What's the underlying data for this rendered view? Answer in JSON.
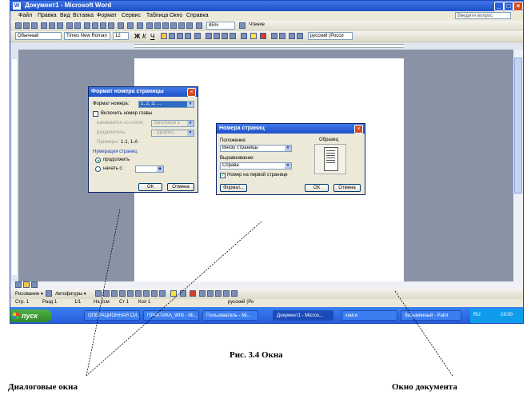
{
  "window": {
    "title": "Документ1 - Microsoft Word",
    "menu": [
      "Файл",
      "Правка",
      "Вид",
      "Вставка",
      "Формат",
      "Сервис",
      "Таблица",
      "Окно",
      "Справка"
    ],
    "help_placeholder": "Введите вопрос",
    "zoom": "85%",
    "reading_label": "Чтение",
    "style": "Обычный",
    "font": "Times New Roman",
    "size": "12",
    "lang_combo": "русский (Росси",
    "drawing_label": "Рисование ▾",
    "autoshapes_label": "Автофигуры ▾"
  },
  "statusbar": {
    "page": "Стр. 1",
    "section": "Разд 1",
    "pages": "1/1",
    "at": "На 2см",
    "line": "Ст 1",
    "col": "Кол 1",
    "lang": "русский (Ро"
  },
  "taskbar": {
    "start": "пуск",
    "tasks": [
      "ОПЕРАЦИОННАЯ СИ...",
      "ПРАКТИКА_WIN - Mi...",
      "Пользователь - Mi...",
      "Документ1 - Micros...",
      "книги",
      "безымянный - Paint"
    ],
    "lang": "RU",
    "clock": "19:00"
  },
  "dialog_page_number_format": {
    "title": "Формат номера страницы",
    "format_label": "Формат номера:",
    "format_value": "1, 2, 3, ...",
    "include_chapter_label": "Включить номер главы",
    "chapter_style_label": "начинается со стиля:",
    "chapter_style_value": "Заголовок 1",
    "separator_label": "разделитель:",
    "separator_value": "- (дефис)",
    "examples_label": "Примеры:",
    "examples_value": "1-1, 1-A",
    "numbering_label": "Нумерация страниц",
    "continue_label": "продолжить",
    "start_at_label": "начать с:",
    "ok": "ОК",
    "cancel": "Отмена"
  },
  "dialog_page_numbers": {
    "title": "Номера страниц",
    "position_label": "Положение:",
    "position_value": "Внизу страницы",
    "alignment_label": "Выравнивание:",
    "alignment_value": "Справа",
    "first_page_label": "Номер на первой странице",
    "preview_label": "Образец",
    "format_button": "Формат...",
    "ok": "ОК",
    "cancel": "Отмена"
  },
  "caption": "Рис. 3.4 Окна",
  "label_dialogs": "Диалоговые окна",
  "label_document": "Окно документа",
  "colors": {
    "title_blue": "#1c4fc7",
    "workspace": "#8a93a6",
    "taskbar": "#2458d8",
    "start_green": "#3a9a32",
    "dialog_face": "#ece9d8"
  }
}
